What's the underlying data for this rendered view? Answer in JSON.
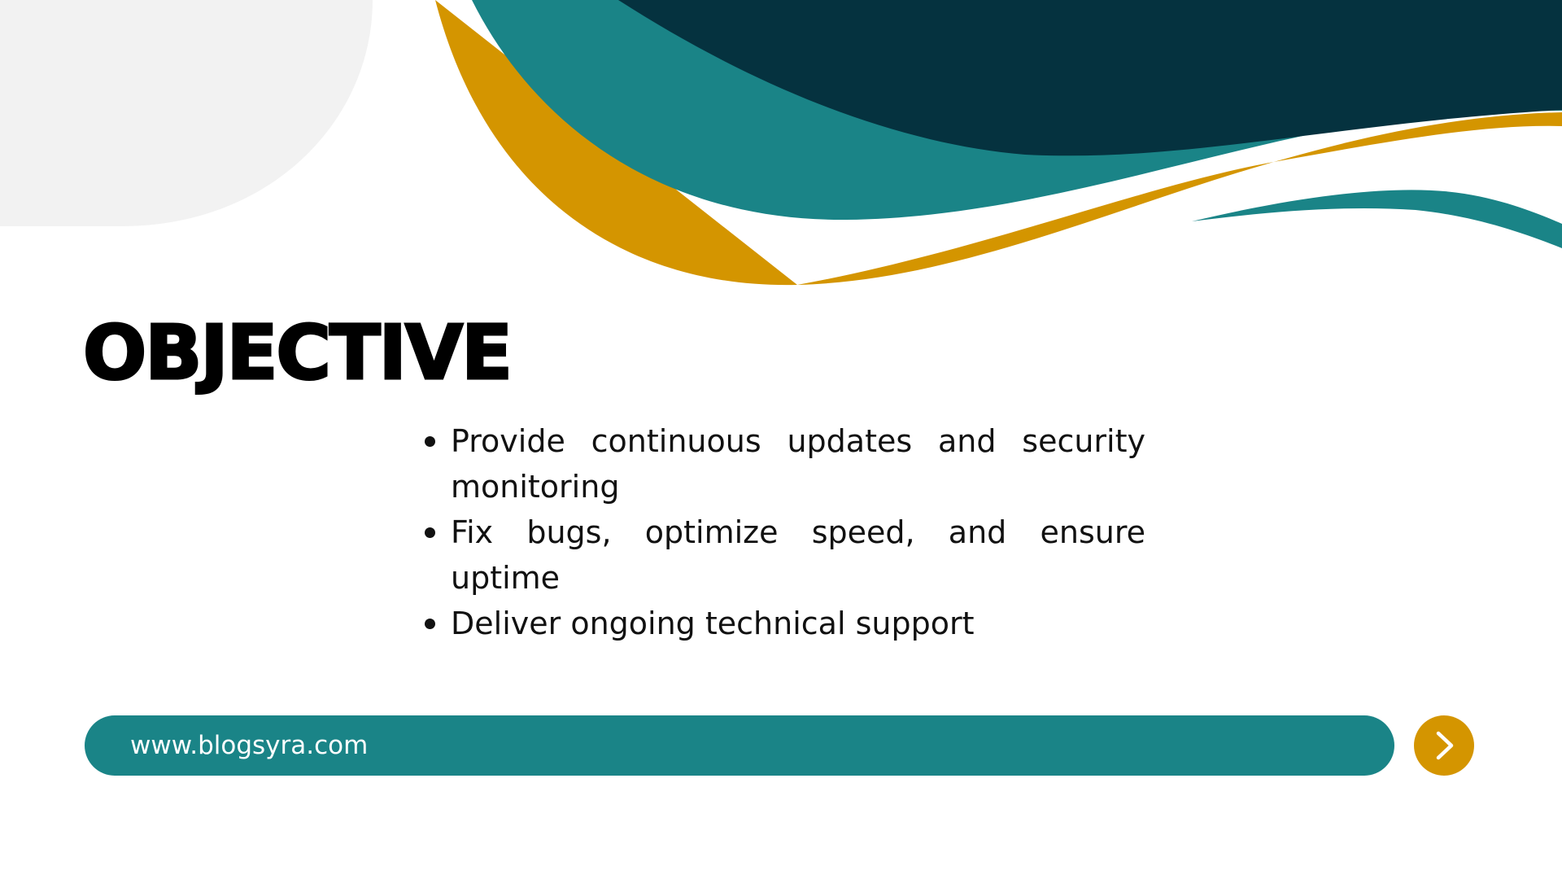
{
  "slide": {
    "title": "OBJECTIVE",
    "bullets": [
      "Provide continuous updates and security monitoring",
      "Fix bugs, optimize speed, and ensure uptime",
      "Deliver ongoing technical support"
    ],
    "footer_url": "www.blogsyra.com",
    "next_icon": "chevron-right-icon"
  },
  "colors": {
    "navy": "#05323f",
    "teal": "#1a8487",
    "gold": "#d49500",
    "light_gray": "#f2f2f2"
  }
}
